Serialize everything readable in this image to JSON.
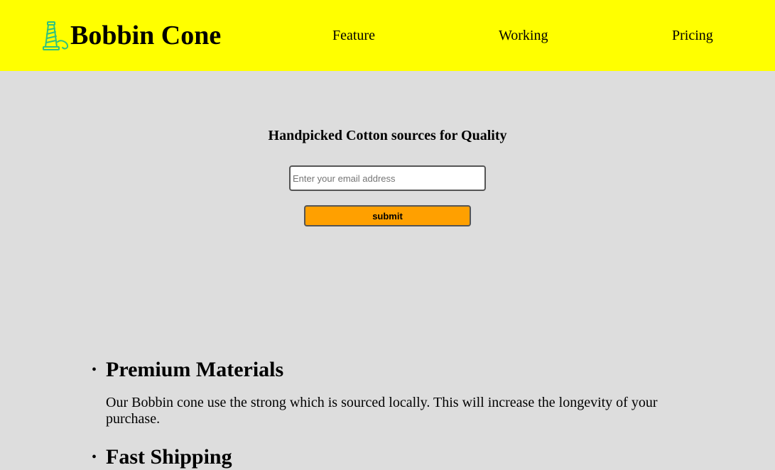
{
  "header": {
    "brand_name": "Bobbin Cone",
    "logo_icon": "bobbin-cone-icon",
    "colors": {
      "background": "#ffff00",
      "logo_green": "#2ec27e"
    },
    "nav": {
      "feature": "Feature",
      "working": "Working",
      "pricing": "Pricing"
    }
  },
  "hero": {
    "title": "Handpicked Cotton sources for Quality",
    "email_placeholder": "Enter your email address",
    "email_value": "",
    "submit_label": "submit",
    "submit_color": "#ffa000"
  },
  "features": [
    {
      "title": "Premium Materials",
      "text": "Our Bobbin cone use the strong which is sourced locally. This will increase the longevity of your purchase."
    },
    {
      "title": "Fast Shipping",
      "text": ""
    }
  ],
  "page": {
    "background": "#dddddd"
  }
}
